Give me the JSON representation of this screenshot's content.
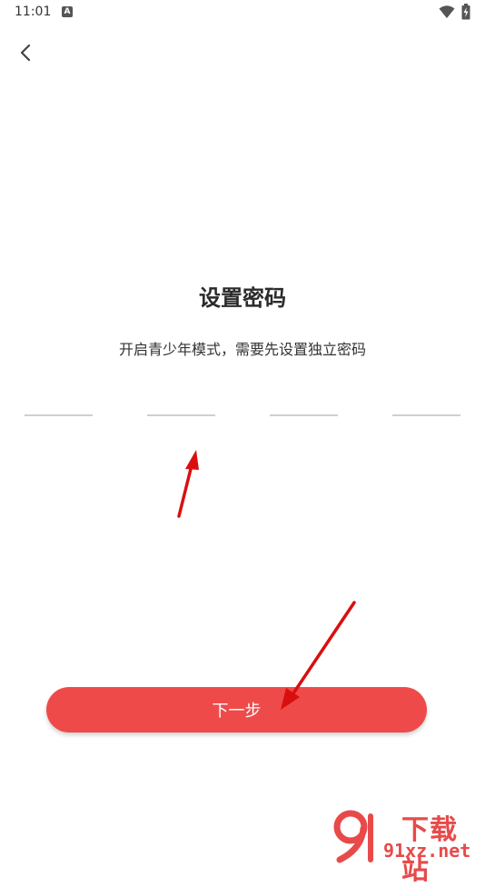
{
  "status_bar": {
    "time": "11:01",
    "notification_icon": "A",
    "icons": [
      "a-notification-icon",
      "wifi-icon",
      "battery-charging-icon"
    ]
  },
  "nav": {
    "back_icon": "chevron-left-icon"
  },
  "main": {
    "title": "设置密码",
    "subtitle": "开启青少年模式，需要先设置独立密码",
    "pin_slots": [
      "",
      "",
      "",
      ""
    ]
  },
  "footer": {
    "next_label": "下一步",
    "accent_color": "#ef4a4a"
  },
  "watermark": {
    "logo_text": "9",
    "brand": "下载站",
    "url": "91xz.net"
  }
}
